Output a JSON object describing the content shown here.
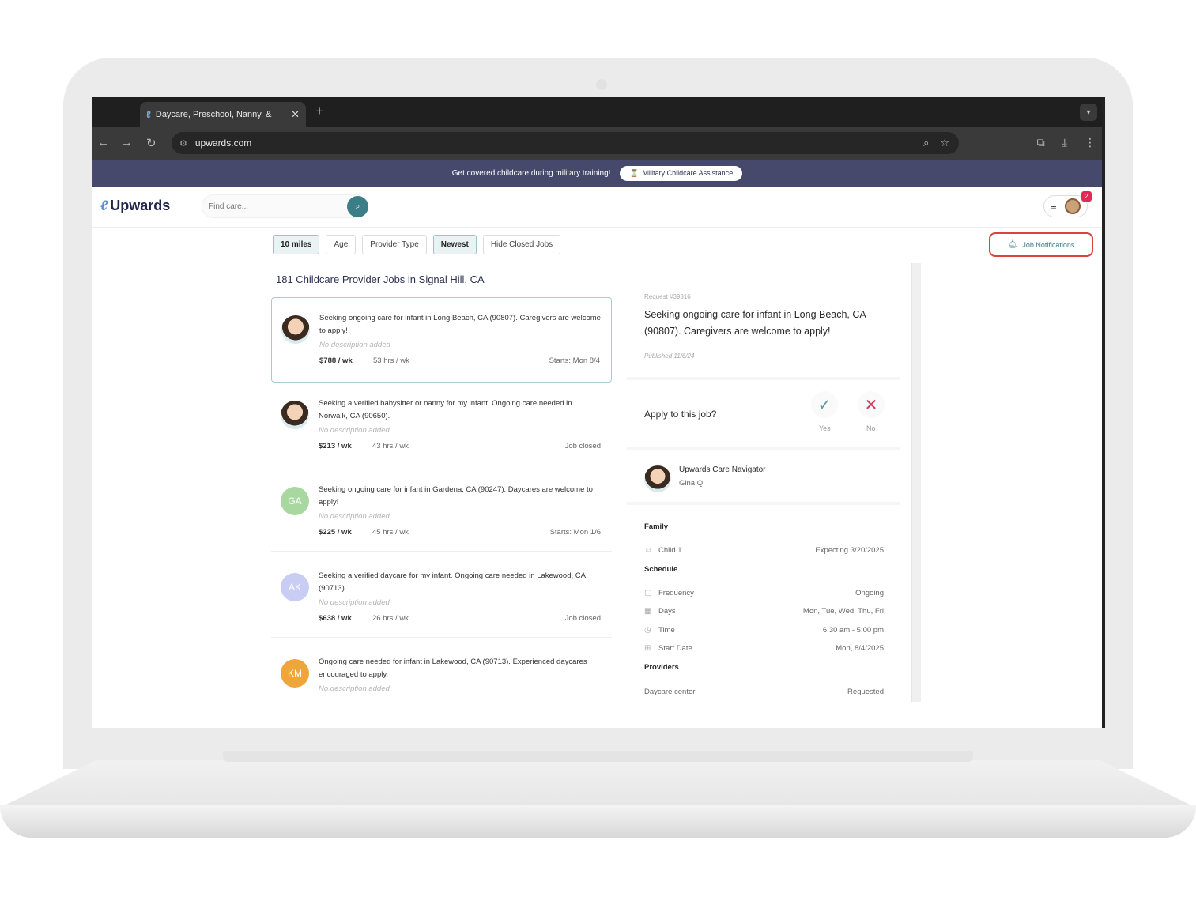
{
  "browser": {
    "tab_title": "Daycare, Preschool, Nanny, &",
    "tab_close": "✕",
    "new_tab": "+",
    "url": "upwards.com"
  },
  "promo": {
    "text": "Get covered childcare during military training!",
    "button": "Military Childcare Assistance"
  },
  "header": {
    "logo": "Upwards",
    "search_placeholder": "Find care...",
    "notification_count": "2"
  },
  "filters": [
    "10 miles",
    "Age",
    "Provider Type",
    "Newest",
    "Hide Closed Jobs"
  ],
  "filters_active": [
    "10 miles",
    "Newest"
  ],
  "job_notifications": "Job Notifications",
  "list_heading": "181 Childcare Provider Jobs in Signal Hill, CA",
  "jobs": [
    {
      "avatar": "",
      "avatar_color": "",
      "title": "Seeking ongoing care for infant in Long Beach, CA (90807). Caregivers are welcome to apply!",
      "desc": "No description added",
      "pay": "$788 / wk",
      "hours": "53 hrs / wk",
      "status": "Starts: Mon 8/4"
    },
    {
      "avatar": "",
      "avatar_color": "",
      "title": "Seeking a verified babysitter or nanny for my infant. Ongoing care needed in Norwalk, CA (90650).",
      "desc": "No description added",
      "pay": "$213 / wk",
      "hours": "43 hrs / wk",
      "status": "Job closed"
    },
    {
      "avatar": "GA",
      "avatar_color": "#a8d8a0",
      "title": "Seeking ongoing care for infant in Gardena, CA (90247). Daycares are welcome to apply!",
      "desc": "No description added",
      "pay": "$225 / wk",
      "hours": "45 hrs / wk",
      "status": "Starts: Mon 1/6"
    },
    {
      "avatar": "AK",
      "avatar_color": "#c9cdf3",
      "title": "Seeking a verified daycare for my infant. Ongoing care needed in Lakewood, CA (90713).",
      "desc": "No description added",
      "pay": "$638 / wk",
      "hours": "26 hrs / wk",
      "status": "Job closed"
    },
    {
      "avatar": "KM",
      "avatar_color": "#f0a53a",
      "title": "Ongoing care needed for infant in Lakewood, CA (90713). Experienced daycares encouraged to apply.",
      "desc": "No description added",
      "pay": "",
      "hours": "",
      "status": ""
    }
  ],
  "detail": {
    "request_id": "Request #39316",
    "title": "Seeking ongoing care for infant in Long Beach, CA (90807). Caregivers are welcome to apply!",
    "published": "Published 11/6/24",
    "apply_question": "Apply to this job?",
    "yes_label": "Yes",
    "no_label": "No",
    "navigator_title": "Upwards Care Navigator",
    "navigator_name": "Gina Q.",
    "family_heading": "Family",
    "child_label": "Child 1",
    "child_value": "Expecting 3/20/2025",
    "schedule_heading": "Schedule",
    "frequency_label": "Frequency",
    "frequency_value": "Ongoing",
    "days_label": "Days",
    "days_value": "Mon, Tue, Wed, Thu, Fri",
    "time_label": "Time",
    "time_value": "6:30 am - 5:00 pm",
    "start_label": "Start Date",
    "start_value": "Mon, 8/4/2025",
    "providers_heading": "Providers",
    "provider_label": "Daycare center",
    "provider_value": "Requested"
  },
  "colors": {
    "brand_navy": "#2e3153",
    "promo_bg": "#46496b",
    "accent_teal": "#3b7e88",
    "highlight_red": "#d9433a"
  }
}
